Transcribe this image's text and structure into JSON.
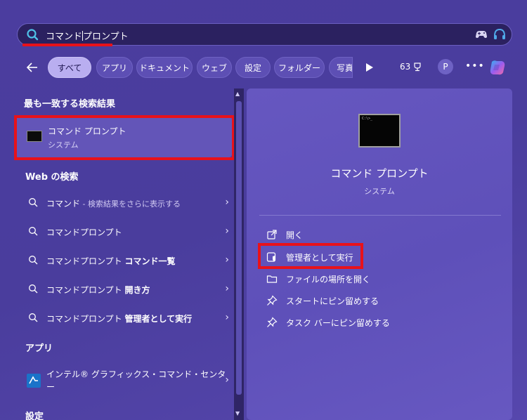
{
  "search": {
    "query_prefix": "コマンド",
    "query_suffix": "プロンプト"
  },
  "filters": {
    "chips": [
      "すべて",
      "アプリ",
      "ドキュメント",
      "ウェブ",
      "設定",
      "フォルダー",
      "写真"
    ],
    "active": "すべて",
    "points": "63",
    "avatar": "P"
  },
  "left": {
    "best_match_title": "最も一致する検索結果",
    "best_match": {
      "title": "コマンド プロンプト",
      "subtitle": "システム"
    },
    "web_title": "Web の検索",
    "web_items": [
      {
        "main": "コマンド",
        "extra": " - 検索結果をさらに表示する"
      },
      {
        "main": "コマンドプロンプト",
        "extra": ""
      },
      {
        "main": "コマンドプロンプト ",
        "bold": "コマンド一覧"
      },
      {
        "main": "コマンドプロンプト ",
        "bold": "開き方"
      },
      {
        "main": "コマンドプロンプト ",
        "bold": "管理者として実行"
      }
    ],
    "apps_title": "アプリ",
    "app_item": {
      "line1": "インテル® グラフィックス・コマンド・センタ",
      "line2": "ー"
    },
    "settings_title": "設定"
  },
  "right": {
    "title": "コマンド プロンプト",
    "subtitle": "システム",
    "actions": [
      {
        "label": "開く",
        "icon": "open-external-icon"
      },
      {
        "label": "管理者として実行",
        "icon": "shield-admin-icon"
      },
      {
        "label": "ファイルの場所を開く",
        "icon": "folder-icon"
      },
      {
        "label": "スタートにピン留めする",
        "icon": "pin-icon"
      },
      {
        "label": "タスク バーにピン留めする",
        "icon": "pin-icon"
      }
    ]
  },
  "colors": {
    "highlight": "#e8121a",
    "accent": "#b9aef0"
  }
}
